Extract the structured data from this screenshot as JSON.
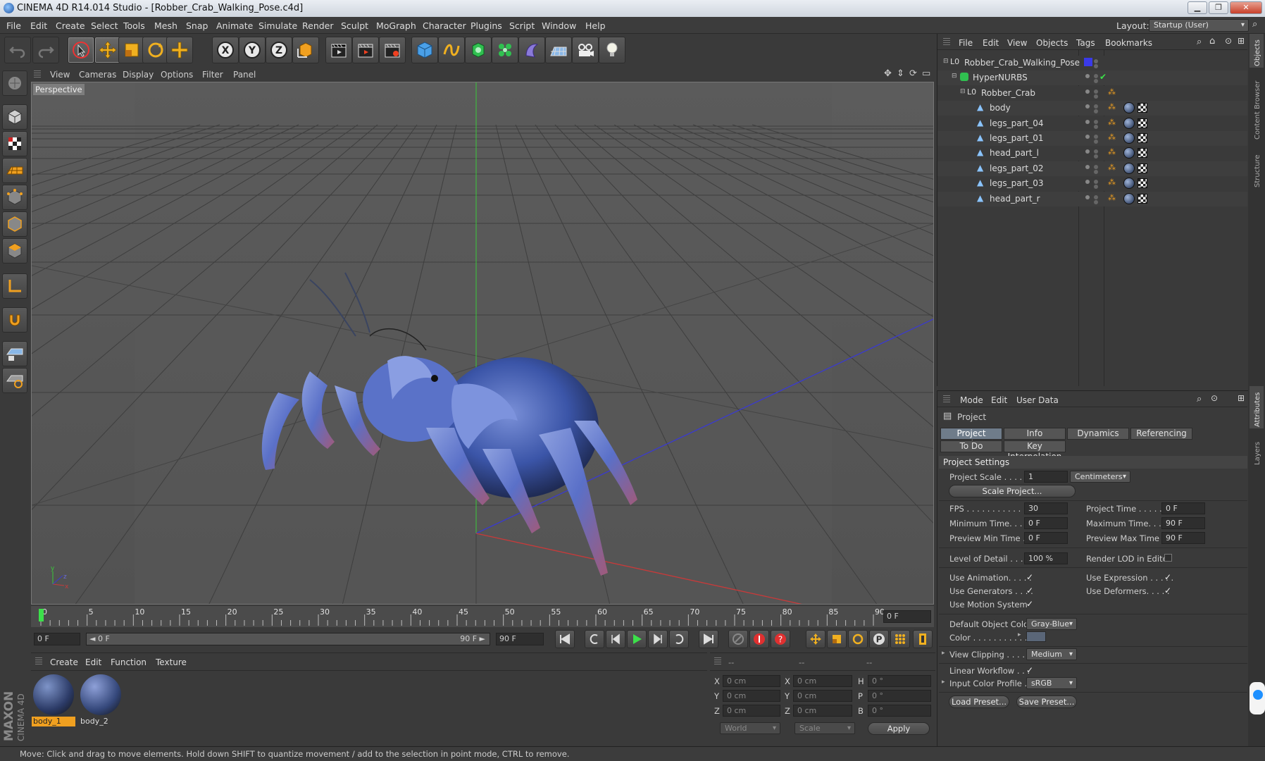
{
  "title_bar": {
    "title": "CINEMA 4D R14.014 Studio - [Robber_Crab_Walking_Pose.c4d]"
  },
  "menu_bar": [
    "File",
    "Edit",
    "Create",
    "Select",
    "Tools",
    "Mesh",
    "Snap",
    "Animate",
    "Simulate",
    "Render",
    "Sculpt",
    "MoGraph",
    "Character",
    "Plugins",
    "Script",
    "Window",
    "Help"
  ],
  "layout": {
    "label": "Layout:",
    "value": "Startup (User)"
  },
  "viewport": {
    "menu": [
      "View",
      "Cameras",
      "Display",
      "Options",
      "Filter",
      "Panel"
    ],
    "label": "Perspective"
  },
  "timeline": {
    "ticks": [
      "0",
      "5",
      "10",
      "15",
      "20",
      "25",
      "30",
      "35",
      "40",
      "45",
      "50",
      "55",
      "60",
      "65",
      "70",
      "75",
      "80",
      "85",
      "90"
    ],
    "current_frame": "0 F"
  },
  "transport": {
    "start": "0 F",
    "range_start": "◄ 0 F",
    "range_end": "90 F ►",
    "end": "90 F"
  },
  "material_manager": {
    "menu": [
      "Create",
      "Edit",
      "Function",
      "Texture"
    ],
    "materials": [
      {
        "name": "body_1",
        "selected": true
      },
      {
        "name": "body_2",
        "selected": false
      }
    ],
    "brand_top": "MAXON",
    "brand_bottom": "CINEMA 4D"
  },
  "coordinates": {
    "headers": [
      "--",
      "--",
      "--"
    ],
    "rows": [
      {
        "a": "X",
        "a_val": "0 cm",
        "b": "X",
        "b_val": "0 cm",
        "c": "H",
        "c_val": "0 °"
      },
      {
        "a": "Y",
        "a_val": "0 cm",
        "b": "Y",
        "b_val": "0 cm",
        "c": "P",
        "c_val": "0 °"
      },
      {
        "a": "Z",
        "a_val": "0 cm",
        "b": "Z",
        "b_val": "0 cm",
        "c": "B",
        "c_val": "0 °"
      }
    ],
    "space": "World",
    "mode": "Scale",
    "apply": "Apply"
  },
  "object_manager": {
    "menu": [
      "File",
      "Edit",
      "View",
      "Objects",
      "Tags",
      "Bookmarks"
    ],
    "objects": [
      {
        "name": "Robber_Crab_Walking_Pose",
        "indent": 0,
        "type": "null"
      },
      {
        "name": "HyperNURBS",
        "indent": 1,
        "type": "nurbs"
      },
      {
        "name": "Robber_Crab",
        "indent": 2,
        "type": "null"
      },
      {
        "name": "body",
        "indent": 3,
        "type": "poly"
      },
      {
        "name": "legs_part_04",
        "indent": 3,
        "type": "poly"
      },
      {
        "name": "legs_part_01",
        "indent": 3,
        "type": "poly"
      },
      {
        "name": "head_part_l",
        "indent": 3,
        "type": "poly"
      },
      {
        "name": "legs_part_02",
        "indent": 3,
        "type": "poly"
      },
      {
        "name": "legs_part_03",
        "indent": 3,
        "type": "poly"
      },
      {
        "name": "head_part_r",
        "indent": 3,
        "type": "poly"
      }
    ]
  },
  "attribute_manager": {
    "menu": [
      "Mode",
      "Edit",
      "User Data"
    ],
    "header": "Project",
    "tabs_row1": [
      "Project Settings",
      "Info",
      "Dynamics",
      "Referencing"
    ],
    "tabs_row2": [
      "To Do",
      "Key Interpolation"
    ],
    "section": "Project Settings",
    "project_scale_label": "Project Scale . . . . . .",
    "project_scale_value": "1",
    "project_scale_unit": "Centimeters",
    "scale_project_button": "Scale Project...",
    "fps_label": "FPS . . . . . . . . . . . . . .",
    "fps_value": "30",
    "project_time_label": "Project Time . . . . . . . .",
    "project_time_value": "0 F",
    "min_time_label": "Minimum Time. . . . . .",
    "min_time_value": "0 F",
    "max_time_label": "Maximum Time. . . . . .",
    "max_time_value": "90 F",
    "preview_min_label": "Preview Min Time . .",
    "preview_min_value": "0 F",
    "preview_max_label": "Preview Max Time . .",
    "preview_max_value": "90 F",
    "lod_label": "Level of Detail . . . . .",
    "lod_value": "100 %",
    "render_lod_label": "Render LOD in Editor",
    "use_animation_label": "Use Animation. . . . .",
    "use_expression_label": "Use Expression . . . . .",
    "use_generators_label": "Use Generators . . . .",
    "use_deformers_label": "Use Deformers. . . . .",
    "use_motion_label": "Use Motion System",
    "default_color_label": "Default Object Color",
    "default_color_value": "Gray-Blue",
    "color_label": "Color . . . . . . . . . . .",
    "view_clipping_label": "View Clipping . . . . . .",
    "view_clipping_value": "Medium",
    "linear_workflow_label": "Linear Workflow . . .",
    "input_color_label": "Input Color Profile . .",
    "input_color_value": "sRGB",
    "load_preset": "Load Preset...",
    "save_preset": "Save Preset...",
    "check": "✓"
  },
  "right_tabs": [
    "Objects",
    "Content Browser",
    "Structure",
    "Attributes",
    "Layers"
  ],
  "status_bar": "Move: Click and drag to move elements. Hold down SHIFT to quantize movement / add to the selection in point mode, CTRL to remove.",
  "colors": {
    "accent": "#f0a020",
    "x_axis": "#c83a3a",
    "y_axis": "#3ac83a",
    "z_axis": "#3a3ad0"
  }
}
